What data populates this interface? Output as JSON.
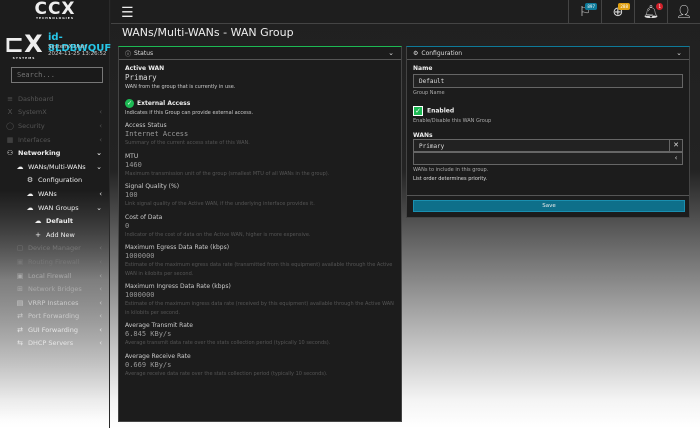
{
  "brand": {
    "logo": "CCX",
    "logo_sub": "TECHNOLOGIES",
    "product": "CX",
    "product_sub": "SYSTEMS"
  },
  "device": {
    "id": "id-8LDBWQUF",
    "user": "SystemX User",
    "time": "2024-11-25 13:26:52"
  },
  "search": {
    "placeholder": "Search..."
  },
  "nav": [
    {
      "label": "Dashboard",
      "icon": "≡"
    },
    {
      "label": "SystemX",
      "icon": "X"
    },
    {
      "label": "Security",
      "icon": "◯"
    },
    {
      "label": "Interfaces",
      "icon": "▦"
    },
    {
      "label": "Networking",
      "icon": "⚇"
    },
    {
      "label": "WANs/Multi-WANs",
      "icon": "☁"
    },
    {
      "label": "Configuration",
      "icon": "⚙"
    },
    {
      "label": "WANs",
      "icon": "☁"
    },
    {
      "label": "WAN Groups",
      "icon": "☁"
    },
    {
      "label": "Default",
      "icon": "☁"
    },
    {
      "label": "Add New",
      "icon": "+"
    },
    {
      "label": "Device Manager",
      "icon": "▢"
    },
    {
      "label": "Routing Firewall",
      "icon": "▣"
    },
    {
      "label": "Local Firewall",
      "icon": "▣"
    },
    {
      "label": "Network Bridges",
      "icon": "⊞"
    },
    {
      "label": "VRRP Instances",
      "icon": "▤"
    },
    {
      "label": "Port Forwarding",
      "icon": "⇄"
    },
    {
      "label": "GUI Forwarding",
      "icon": "⇄"
    },
    {
      "label": "DHCP Servers",
      "icon": "⇆"
    }
  ],
  "topbar": {
    "badges": [
      "897",
      "288",
      "1"
    ],
    "colors": {
      "flag": "#0e7a99",
      "target": "#e0a010",
      "bell": "#d0202a"
    }
  },
  "page_title": "WANs/Multi-WANs - WAN Group",
  "status": {
    "title": "Status",
    "active_wan": {
      "label": "Active WAN",
      "value": "Primary",
      "desc": "WAN from the group that is currently in use."
    },
    "external": {
      "label": "External Access",
      "desc": "Indicates if this Group can provide external access."
    },
    "fields": [
      {
        "label": "Access Status",
        "value": "Internet Access",
        "desc": "Summary of the current access state of this WAN."
      },
      {
        "label": "MTU",
        "value": "1460",
        "desc": "Maximum transmission unit of the group (smallest MTU of all WANs in the group)."
      },
      {
        "label": "Signal Quality (%)",
        "value": "100",
        "desc": "Link signal quality of the Active WAN, if the underlying interface provides it."
      },
      {
        "label": "Cost of Data",
        "value": "0",
        "desc": "Indicator of the cost of data on the Active WAN, higher is more expensive."
      },
      {
        "label": "Maximum Egress Data Rate (kbps)",
        "value": "1000000",
        "desc": "Estimate of the maximum egress data rate (transmitted from this equipment) available through the Active WAN in kilobits per second."
      },
      {
        "label": "Maximum Ingress Data Rate (kbps)",
        "value": "1000000",
        "desc": "Estimate of the maximum ingress data rate (received by this equipment) available through the Active WAN in kilobits per second."
      },
      {
        "label": "Average Transmit Rate",
        "value": "6.845 KBy/s",
        "desc": "Average transmit data rate over the stats collection period (typically 10 seconds)."
      },
      {
        "label": "Average Receive Rate",
        "value": "0.669 KBy/s",
        "desc": "Average receive data rate over the stats collection period (typically 10 seconds)."
      }
    ]
  },
  "config": {
    "title": "Configuration",
    "name_label": "Name",
    "name_value": "Default",
    "name_desc": "Group Name",
    "enabled_label": "Enabled",
    "enabled_desc": "Enable/Disable this WAN Group",
    "wans_label": "WANs",
    "wans": [
      "Primary"
    ],
    "wans_desc1": "WANs to include in this group.",
    "wans_desc2": "List order determines priority.",
    "save": "Save"
  }
}
